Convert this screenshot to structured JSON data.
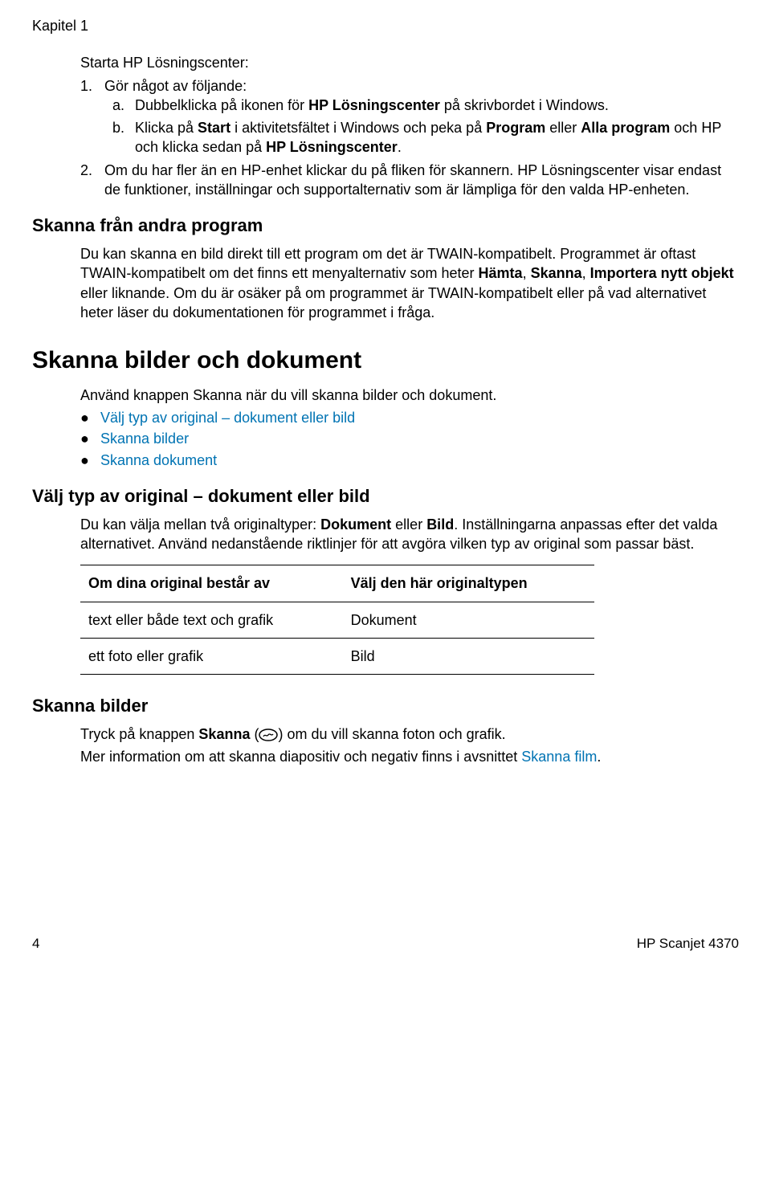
{
  "chapter": "Kapitel 1",
  "start_title": "Starta HP Lösningscenter:",
  "step1_marker": "1.",
  "step1_text": "Gör något av följande:",
  "step1a_marker": "a.",
  "step1a_pre": "Dubbelklicka på ikonen för ",
  "step1a_bold": "HP Lösningscenter",
  "step1a_post": " på skrivbordet i Windows.",
  "step1b_marker": "b.",
  "step1b_1": "Klicka på ",
  "step1b_b1": "Start",
  "step1b_2": " i aktivitetsfältet i Windows och peka på ",
  "step1b_b2": "Program",
  "step1b_3": " eller ",
  "step1b_b3": "Alla program",
  "step1b_4": " och HP och klicka sedan på ",
  "step1b_b4": "HP Lösningscenter",
  "step1b_5": ".",
  "step2_marker": "2.",
  "step2_text": "Om du har fler än en HP-enhet klickar du på fliken för skannern. HP Lösningscenter visar endast de funktioner, inställningar och supportalternativ som är lämpliga för den valda HP-enheten.",
  "scan_from_other_heading": "Skanna från andra program",
  "scan_from_other_para_pre": "Du kan skanna en bild direkt till ett program om det är TWAIN-kompatibelt. Programmet är oftast TWAIN-kompatibelt om det finns ett menyalternativ som heter ",
  "sfo_b1": "Hämta",
  "sfo_c1": ", ",
  "sfo_b2": "Skanna",
  "sfo_c2": ", ",
  "sfo_b3": "Importera nytt objekt",
  "sfo_post": " eller liknande. Om du är osäker på om programmet är TWAIN-kompatibelt eller på vad alternativet heter läser du dokumentationen för programmet i fråga.",
  "scan_pics_docs_heading": "Skanna bilder och dokument",
  "scan_pics_docs_para": "Använd knappen Skanna när du vill skanna bilder och dokument.",
  "bullet1": "Välj typ av original – dokument eller bild",
  "bullet2": "Skanna bilder",
  "bullet3": "Skanna dokument",
  "choose_type_heading": "Välj typ av original – dokument eller bild",
  "choose_type_para_1": "Du kan välja mellan två originaltyper: ",
  "ct_b1": "Dokument",
  "ct_mid": " eller ",
  "ct_b2": "Bild",
  "ct_post": ". Inställningarna anpassas efter det valda alternativet. Använd nedanstående riktlinjer för att avgöra vilken typ av original som passar bäst.",
  "th1": "Om dina original består av",
  "th2": "Välj den här originaltypen",
  "r1c1": "text eller både text och grafik",
  "r1c2": "Dokument",
  "r2c1": "ett foto eller grafik",
  "r2c2": "Bild",
  "scan_pics_heading": "Skanna bilder",
  "scan_pics_p1a": "Tryck på knappen ",
  "scan_pics_p1b": "Skanna",
  "scan_pics_p1c": " (",
  "scan_pics_p1d": ") om du vill skanna foton och grafik.",
  "scan_pics_p2a": "Mer information om att skanna diapositiv och negativ finns i avsnittet ",
  "scan_pics_p2link": "Skanna film",
  "scan_pics_p2b": ".",
  "footer_page": "4",
  "footer_model": "HP Scanjet 4370"
}
